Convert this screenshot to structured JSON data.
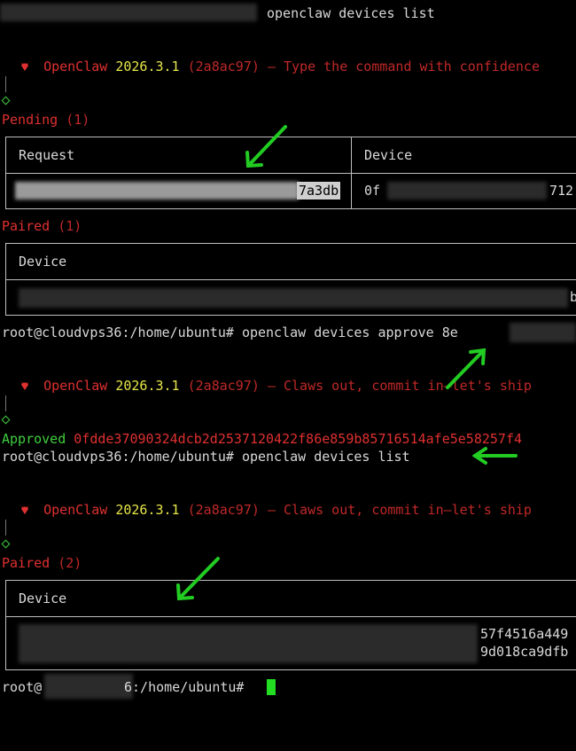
{
  "line1_cmd": "openclaw devices list",
  "banner1": {
    "app": "OpenClaw",
    "version": "2026.3.1",
    "hash": "(2a8ac97)",
    "tagline": "— Type the command with confidence"
  },
  "pending": {
    "title": "Pending",
    "count": "(1)",
    "col_request": "Request",
    "col_device": "Device",
    "request_suffix": "7a3db",
    "device_prefix": "0f",
    "device_suffix": "712"
  },
  "paired1": {
    "title": "Paired",
    "count": "(1)",
    "col_device": "Device",
    "device_suffix": "b"
  },
  "approve_line": {
    "prompt": "root@cloudvps36:/home/ubuntu#",
    "cmd": "openclaw devices approve 8e"
  },
  "banner2": {
    "app": "OpenClaw",
    "version": "2026.3.1",
    "hash": "(2a8ac97)",
    "tagline": "— Claws out, commit in—let's ship"
  },
  "approved": {
    "label": "Approved",
    "id": "0fdde37090324dcb2d2537120422f86e859b85716514afe5e58257f4"
  },
  "list_line": {
    "prompt": "root@cloudvps36:/home/ubuntu#",
    "cmd": "openclaw devices list"
  },
  "banner3": {
    "app": "OpenClaw",
    "version": "2026.3.1",
    "hash": "(2a8ac97)",
    "tagline": "— Claws out, commit in—let's ship"
  },
  "paired2": {
    "title": "Paired",
    "count": "(2)",
    "col_device": "Device",
    "row1_suffix": "57f4516a449",
    "row2_suffix": "9d018ca9dfb"
  },
  "final_prompt": {
    "user": "root@",
    "path": "6:/home/ubuntu#"
  },
  "colors": {
    "arrow": "#22cc22",
    "accent_red": "#e03030",
    "accent_yellow": "#e6e64a",
    "accent_green": "#3fcf3f",
    "cursor": "#22dd22"
  }
}
